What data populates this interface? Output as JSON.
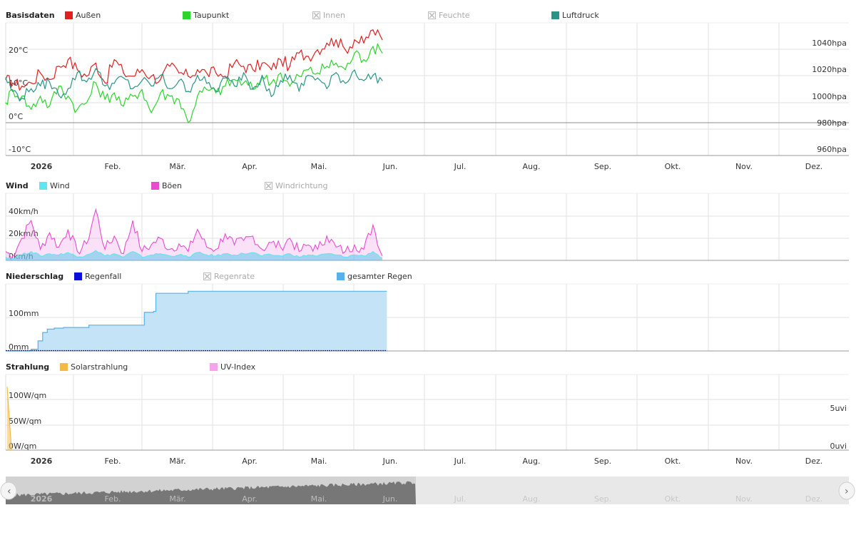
{
  "colors": {
    "aussen": "#e02020",
    "taupunkt": "#2ed42e",
    "luftdruck": "#2a9486",
    "wind": "#5fe6f2",
    "boeen": "#e64ccf",
    "regenfall": "#0a10d8",
    "gesamter_regen": "#58b1ea",
    "solar": "#f5b948",
    "uv": "#f5a3ee",
    "disabled": "#bbbbbb",
    "grid": "#e2e2e2",
    "axis": "#999999"
  },
  "months": [
    "2026",
    "Feb.",
    "Mär.",
    "Apr.",
    "Mai.",
    "Jun.",
    "Jul.",
    "Aug.",
    "Sep.",
    "Okt.",
    "Nov.",
    "Dez."
  ],
  "chart_data": [
    {
      "id": "basisdaten",
      "type": "line",
      "title": "Basisdaten",
      "legend": [
        {
          "name": "Außen",
          "color": "#e02020",
          "enabled": true
        },
        {
          "name": "Taupunkt",
          "color": "#2ed42e",
          "enabled": true
        },
        {
          "name": "Innen",
          "color": "#bbbbbb",
          "enabled": false
        },
        {
          "name": "Feuchte",
          "color": "#bbbbbb",
          "enabled": false
        },
        {
          "name": "Luftdruck",
          "color": "#2a9486",
          "enabled": true
        }
      ],
      "y_ticks_left": [
        "20°C",
        "10°C",
        "0°C",
        "-10°C"
      ],
      "y_ticks_right": [
        "1040hpa",
        "1020hpa",
        "1000hpa",
        "980hpa",
        "960hpa"
      ],
      "ylim_left": [
        -10,
        30
      ],
      "ylim_right": [
        960,
        1060
      ],
      "x_day_range": [
        1,
        365
      ],
      "series": [
        {
          "name": "Außen",
          "color": "#e02020",
          "unit": "°C",
          "x": [
            1,
            4,
            8,
            12,
            16,
            20,
            24,
            28,
            32,
            36,
            40,
            44,
            48,
            52,
            56,
            60,
            64,
            68,
            72,
            76,
            80,
            84,
            88,
            92,
            96,
            100,
            104,
            108,
            112,
            116,
            120,
            124,
            128,
            132,
            136,
            140,
            144,
            148,
            152,
            156,
            160,
            164
          ],
          "values": [
            13,
            12,
            11,
            12,
            15,
            13,
            17,
            19,
            16,
            14,
            18,
            12,
            19,
            15,
            14,
            16,
            14,
            13,
            17,
            15,
            14,
            16,
            15,
            15,
            14,
            18,
            17,
            16,
            18,
            16,
            19,
            17,
            21,
            20,
            22,
            24,
            25,
            22,
            25,
            24,
            28,
            25
          ]
        },
        {
          "name": "Taupunkt",
          "color": "#2ed42e",
          "unit": "°C",
          "x": [
            1,
            4,
            8,
            12,
            16,
            20,
            24,
            28,
            32,
            36,
            40,
            44,
            48,
            52,
            56,
            60,
            64,
            68,
            72,
            76,
            80,
            84,
            88,
            92,
            96,
            100,
            104,
            108,
            112,
            116,
            120,
            124,
            128,
            132,
            136,
            140,
            144,
            148,
            152,
            156,
            160,
            164
          ],
          "values": [
            6,
            10,
            8,
            4,
            8,
            5,
            11,
            8,
            4,
            6,
            12,
            7,
            9,
            5,
            8,
            10,
            3,
            9,
            8,
            7,
            0,
            8,
            10,
            9,
            11,
            13,
            12,
            10,
            14,
            12,
            15,
            11,
            14,
            16,
            15,
            17,
            18,
            16,
            21,
            19,
            23,
            21
          ]
        },
        {
          "name": "Luftdruck",
          "color": "#2a9486",
          "unit": "hpa",
          "x": [
            1,
            4,
            8,
            12,
            16,
            20,
            24,
            28,
            32,
            36,
            40,
            44,
            48,
            52,
            56,
            60,
            64,
            68,
            72,
            76,
            80,
            84,
            88,
            92,
            96,
            100,
            104,
            108,
            112,
            116,
            120,
            124,
            128,
            132,
            136,
            140,
            144,
            148,
            152,
            156,
            160,
            164
          ],
          "values": [
            1018,
            1008,
            1003,
            1010,
            1012,
            1015,
            1005,
            1010,
            1022,
            1015,
            1025,
            1012,
            1014,
            1018,
            1010,
            1016,
            1012,
            1020,
            1010,
            1016,
            1008,
            1020,
            1014,
            1008,
            1018,
            1012,
            1022,
            1010,
            1020,
            1004,
            1016,
            1020,
            1008,
            1020,
            1018,
            1010,
            1022,
            1014,
            1024,
            1016,
            1020,
            1016
          ]
        }
      ]
    },
    {
      "id": "wind",
      "type": "area",
      "title": "Wind",
      "legend": [
        {
          "name": "Wind",
          "color": "#5fe6f2",
          "enabled": true
        },
        {
          "name": "Böen",
          "color": "#e64ccf",
          "enabled": true
        },
        {
          "name": "Windrichtung",
          "color": "#bbbbbb",
          "enabled": false
        }
      ],
      "y_ticks_left": [
        "40km/h",
        "20km/h",
        "0km/h"
      ],
      "ylim": [
        0,
        50
      ],
      "series": [
        {
          "name": "Böen",
          "color": "#e64ccf",
          "unit": "km/h",
          "x": [
            1,
            4,
            8,
            12,
            16,
            20,
            24,
            28,
            32,
            36,
            40,
            44,
            48,
            52,
            56,
            60,
            64,
            68,
            72,
            76,
            80,
            84,
            88,
            92,
            96,
            100,
            104,
            108,
            112,
            116,
            120,
            124,
            128,
            132,
            136,
            140,
            144,
            148,
            152,
            156,
            160,
            164
          ],
          "values": [
            8,
            4,
            20,
            36,
            10,
            25,
            12,
            28,
            8,
            15,
            46,
            10,
            22,
            6,
            36,
            8,
            14,
            20,
            10,
            15,
            8,
            28,
            12,
            10,
            24,
            14,
            18,
            22,
            10,
            16,
            12,
            20,
            8,
            14,
            10,
            22,
            12,
            8,
            14,
            10,
            32,
            4
          ]
        },
        {
          "name": "Wind",
          "color": "#5fe6f2",
          "unit": "km/h",
          "x": [
            1,
            4,
            8,
            12,
            16,
            20,
            24,
            28,
            32,
            36,
            40,
            44,
            48,
            52,
            56,
            60,
            64,
            68,
            72,
            76,
            80,
            84,
            88,
            92,
            96,
            100,
            104,
            108,
            112,
            116,
            120,
            124,
            128,
            132,
            136,
            140,
            144,
            148,
            152,
            156,
            160,
            164
          ],
          "values": [
            3,
            2,
            5,
            8,
            4,
            6,
            5,
            7,
            3,
            5,
            9,
            4,
            6,
            3,
            8,
            3,
            5,
            6,
            4,
            5,
            3,
            7,
            5,
            4,
            6,
            5,
            6,
            7,
            4,
            5,
            4,
            6,
            3,
            5,
            4,
            6,
            5,
            3,
            5,
            4,
            8,
            2
          ]
        }
      ]
    },
    {
      "id": "niederschlag",
      "type": "area",
      "title": "Niederschlag",
      "legend": [
        {
          "name": "Regenfall",
          "color": "#0a10d8",
          "enabled": true
        },
        {
          "name": "Regenrate",
          "color": "#bbbbbb",
          "enabled": false
        },
        {
          "name": "gesamter Regen",
          "color": "#58b1ea",
          "enabled": true
        }
      ],
      "y_ticks_left": [
        "100mm",
        "0mm"
      ],
      "ylim": [
        0,
        200
      ],
      "series": [
        {
          "name": "gesamter Regen",
          "color": "#58b1ea",
          "unit": "mm",
          "x": [
            1,
            12,
            15,
            17,
            19,
            22,
            26,
            37,
            45,
            59,
            61,
            65,
            66,
            80,
            100,
            130,
            166
          ],
          "values": [
            0,
            5,
            30,
            55,
            65,
            68,
            70,
            77,
            77,
            77,
            115,
            118,
            172,
            178,
            178,
            178,
            178
          ]
        },
        {
          "name": "Regenfall",
          "color": "#0a10d8",
          "unit": "mm",
          "x": [
            1,
            166
          ],
          "values": [
            0,
            0
          ]
        }
      ]
    },
    {
      "id": "strahlung",
      "type": "line",
      "title": "Strahlung",
      "legend": [
        {
          "name": "Solarstrahlung",
          "color": "#f5b948",
          "enabled": true
        },
        {
          "name": "UV-Index",
          "color": "#f5a3ee",
          "enabled": true
        }
      ],
      "y_ticks_left": [
        "100W/qm",
        "50W/qm",
        "0W/qm"
      ],
      "y_ticks_right": [
        "5uvi",
        "0uvi"
      ],
      "ylim": [
        0,
        150
      ],
      "series": [
        {
          "name": "Solarstrahlung",
          "color": "#f5b948",
          "unit": "W/qm",
          "x": [
            1,
            1.5,
            2
          ],
          "values": [
            125,
            60,
            0
          ]
        }
      ]
    }
  ],
  "navigator": {
    "months": [
      "2026",
      "Feb.",
      "Mär.",
      "Apr.",
      "Mai.",
      "Jun.",
      "Jul.",
      "Aug.",
      "Sep.",
      "Okt.",
      "Nov.",
      "Dez."
    ],
    "left_handle": "‹",
    "right_handle": "›"
  }
}
